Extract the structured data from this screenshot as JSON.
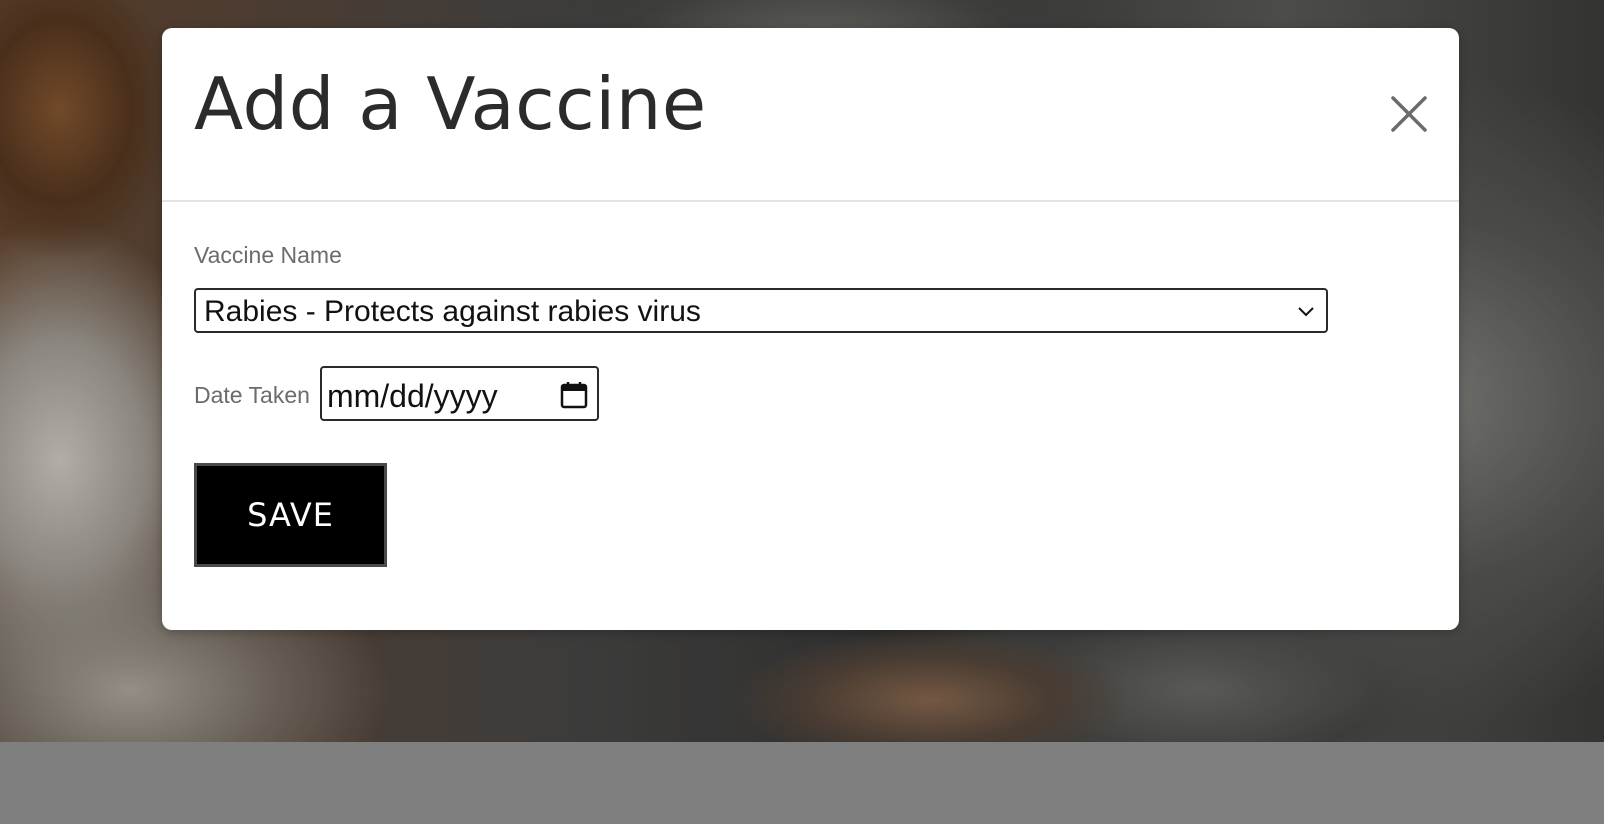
{
  "modal": {
    "title": "Add a Vaccine",
    "close_icon": "close-icon"
  },
  "form": {
    "vaccine_name_label": "Vaccine Name",
    "vaccine_selected": "Rabies - Protects against rabies virus",
    "date_label": "Date Taken",
    "date_placeholder": "mm/dd/yyyy",
    "save_label": "SAVE"
  },
  "colors": {
    "save_button_bg": "#000000",
    "footer_bar": "#7f7f7f"
  }
}
